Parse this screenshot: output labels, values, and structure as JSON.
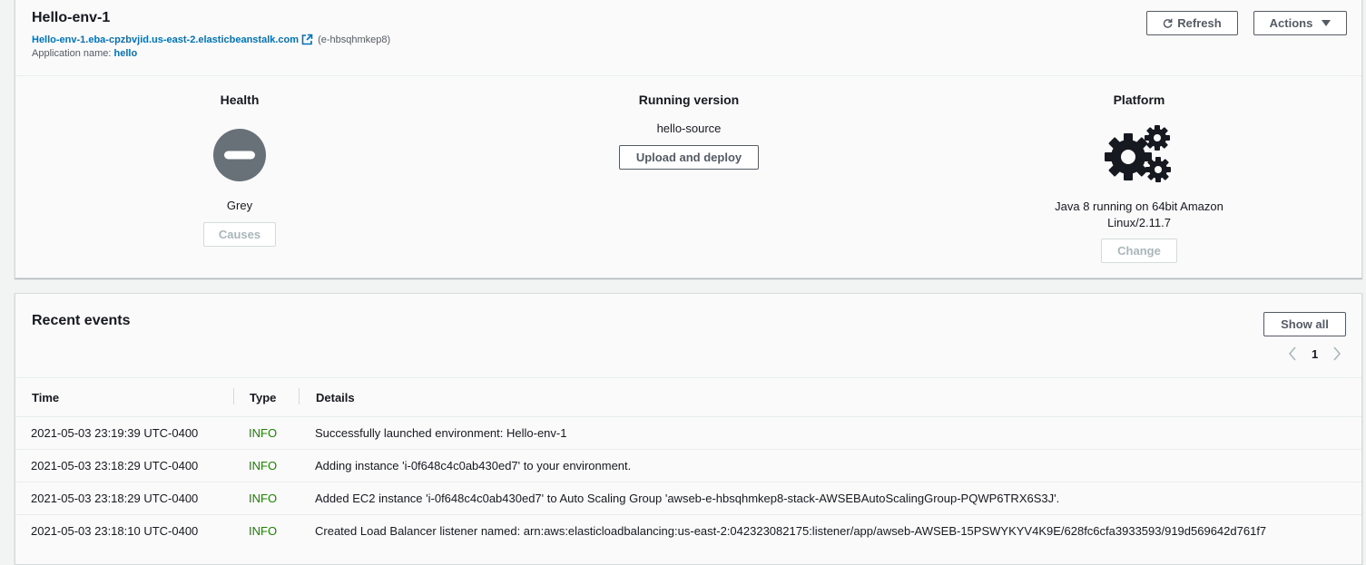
{
  "environment": {
    "name": "Hello-env-1",
    "url": "Hello-env-1.eba-cpzbvjid.us-east-2.elasticbeanstalk.com",
    "id": "(e-hbsqhmkep8)",
    "app_label": "Application name:",
    "app_name": "hello",
    "refresh_label": "Refresh",
    "actions_label": "Actions"
  },
  "health": {
    "title": "Health",
    "status": "Grey",
    "causes_label": "Causes",
    "status_color": "#687078"
  },
  "running_version": {
    "title": "Running version",
    "version": "hello-source",
    "deploy_label": "Upload and deploy"
  },
  "platform": {
    "title": "Platform",
    "line1": "Java 8 running on 64bit Amazon",
    "line2": "Linux/2.11.7",
    "change_label": "Change"
  },
  "events": {
    "title": "Recent events",
    "show_all_label": "Show all",
    "page": "1",
    "columns": [
      "Time",
      "Type",
      "Details"
    ],
    "rows": [
      {
        "time": "2021-05-03 23:19:39 UTC-0400",
        "type": "INFO",
        "details": "Successfully launched environment: Hello-env-1"
      },
      {
        "time": "2021-05-03 23:18:29 UTC-0400",
        "type": "INFO",
        "details": "Adding instance 'i-0f648c4c0ab430ed7' to your environment."
      },
      {
        "time": "2021-05-03 23:18:29 UTC-0400",
        "type": "INFO",
        "details": "Added EC2 instance 'i-0f648c4c0ab430ed7' to Auto Scaling Group 'awseb-e-hbsqhmkep8-stack-AWSEBAutoScalingGroup-PQWP6TRX6S3J'."
      },
      {
        "time": "2021-05-03 23:18:10 UTC-0400",
        "type": "INFO",
        "details": "Created Load Balancer listener named: arn:aws:elasticloadbalancing:us-east-2:042323082175:listener/app/awseb-AWSEB-15PSWYKYV4K9E/628fc6cfa3933593/919d569642d761f7"
      }
    ]
  },
  "colors": {
    "link": "#0073bb",
    "info": "#1d8102",
    "border": "#d5dbdb"
  },
  "icons": [
    "external-link-icon",
    "refresh-icon",
    "caret-down-icon",
    "health-grey-icon",
    "gears-icon",
    "chevron-left-icon",
    "chevron-right-icon"
  ]
}
